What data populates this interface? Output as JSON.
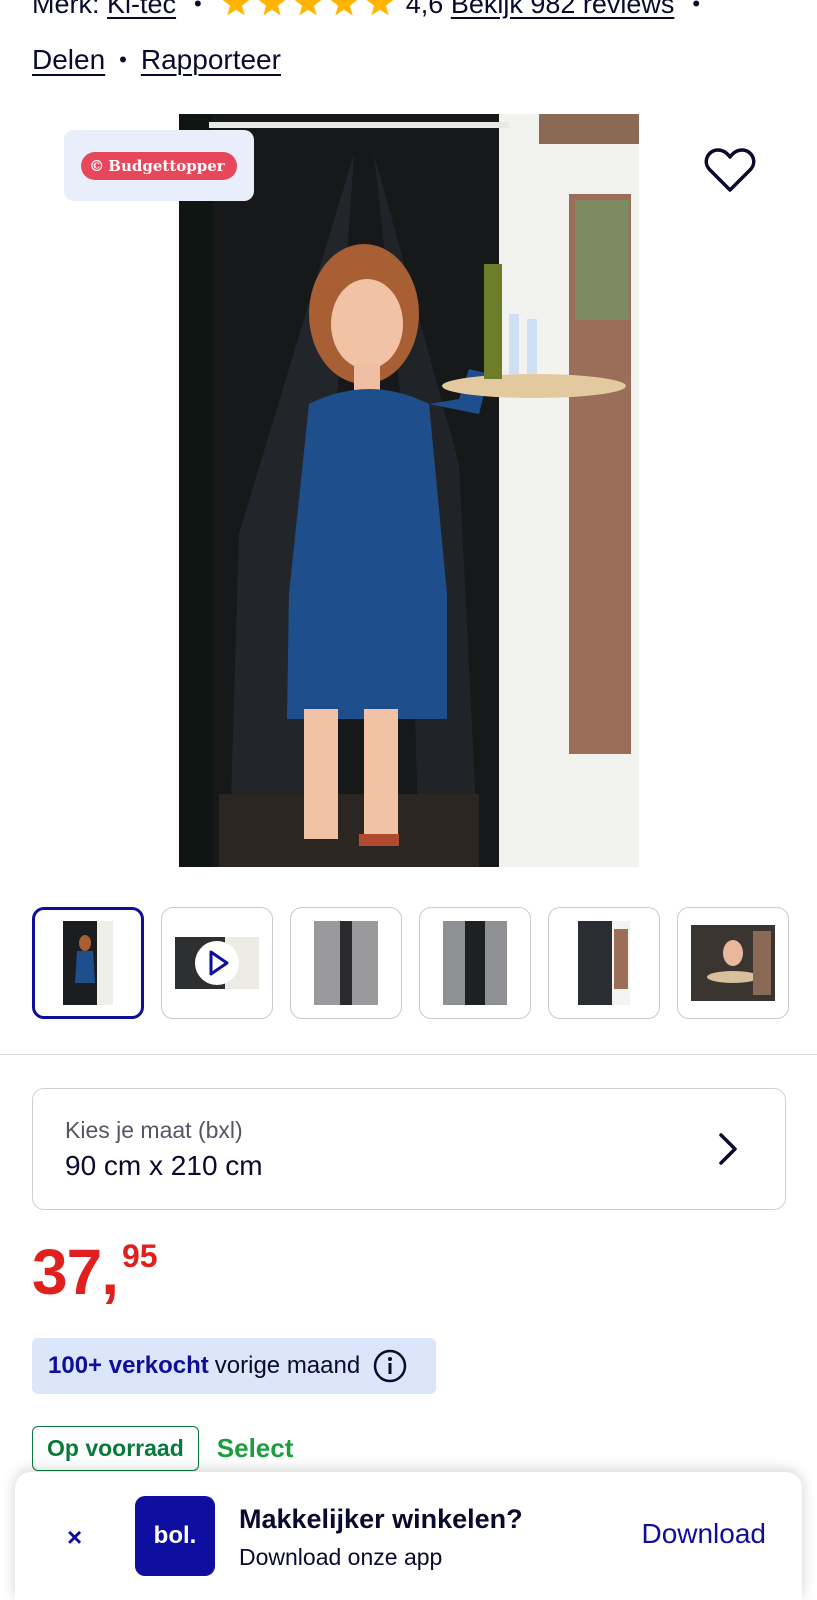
{
  "meta": {
    "brand_prefix": "Merk:",
    "brand_name": "Ki-tec",
    "rating": "4,6",
    "reviews_link": "Bekijk 982 reviews",
    "star_color": "#ffb400"
  },
  "actions": {
    "share": "Delen",
    "report": "Rapporteer"
  },
  "badge": {
    "label": "Budgettopper",
    "color": "#e6475b"
  },
  "gallery": {
    "thumbnails": [
      {
        "kind": "photo",
        "active": true
      },
      {
        "kind": "video",
        "active": false
      },
      {
        "kind": "photo",
        "active": false
      },
      {
        "kind": "photo",
        "active": false
      },
      {
        "kind": "photo",
        "active": false
      },
      {
        "kind": "photo",
        "active": false
      }
    ]
  },
  "size": {
    "label": "Kies je maat (bxl)",
    "value": "90 cm x 210 cm"
  },
  "price": {
    "euros": "37,",
    "cents": "95",
    "color": "#e0201f"
  },
  "sales": {
    "count": "100+ verkocht",
    "text": "vorige maand"
  },
  "stock": {
    "status": "Op voorraad",
    "program": "Select"
  },
  "app_banner": {
    "close": "×",
    "logo": "bol.",
    "title": "Makkelijker winkelen?",
    "subtitle": "Download onze app",
    "download": "Download",
    "accent": "#0e0e9a"
  }
}
